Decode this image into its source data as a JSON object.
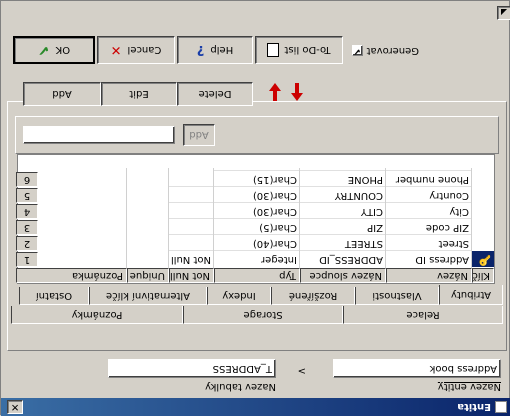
{
  "window": {
    "title": "Entita"
  },
  "entity": {
    "label": "Nazev entity",
    "value": "Address book"
  },
  "table": {
    "label": "Nazev tabulky",
    "value": "T_ADDRESS"
  },
  "arrow_glyph": ">",
  "tabs_row1": [
    "Relace",
    "Storage",
    "Poznámky"
  ],
  "tabs_row2": [
    "Atributy",
    "Vlastnosti",
    "Rozšířené",
    "Indexy",
    "Alternativní klíče",
    "Ostatní"
  ],
  "grid": {
    "headers": [
      "Klíč",
      "Název",
      "Název sloupce",
      "Typ",
      "Not Null",
      "Unique",
      "Poznámka"
    ],
    "rows": [
      {
        "num": "1",
        "key": true,
        "name": "Address ID",
        "column": "ADDRESS_ID",
        "type": "Integer",
        "notnull": "Not Null"
      },
      {
        "num": "2",
        "key": false,
        "name": "Street",
        "column": "STREET",
        "type": "Char(40)",
        "notnull": ""
      },
      {
        "num": "3",
        "key": false,
        "name": "ZIP code",
        "column": "ZIP",
        "type": "Char(5)",
        "notnull": ""
      },
      {
        "num": "4",
        "key": false,
        "name": "City",
        "column": "CITY",
        "type": "Char(30)",
        "notnull": ""
      },
      {
        "num": "5",
        "key": false,
        "name": "Country",
        "column": "COUNTRY",
        "type": "Char(30)",
        "notnull": ""
      },
      {
        "num": "6",
        "key": false,
        "name": "Phone number",
        "column": "PHONE",
        "type": "Char(15)",
        "notnull": ""
      }
    ]
  },
  "add_small": {
    "label": "Add",
    "value": ""
  },
  "grid_buttons": {
    "add": "Add",
    "edit": "Edit",
    "delete": "Delete"
  },
  "bottom_buttons": {
    "ok": "OK",
    "cancel": "Cancel",
    "help": "Help",
    "todo": "To-Do list"
  },
  "generate": {
    "label": "Generovat",
    "checked": true
  },
  "colors": {
    "title": "#0a246a",
    "accent_red": "#cc0000",
    "ok_green": "#2a8a2a",
    "key_yellow": "#e8c400"
  }
}
